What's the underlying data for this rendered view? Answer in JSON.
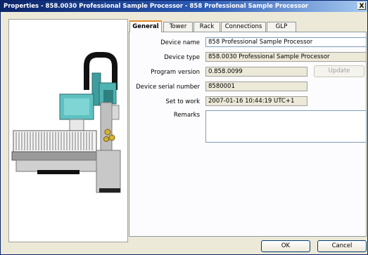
{
  "window": {
    "title": "Properties - 858.0030 Professional Sample Processor - 858 Professional Sample Processor",
    "close_label": "X"
  },
  "tabs": [
    "General",
    "Tower",
    "Rack",
    "Connections",
    "GLP"
  ],
  "general": {
    "device_name_label": "Device name",
    "device_name_value": "858 Professional Sample Processor",
    "device_type_label": "Device type",
    "device_type_value": "858.0030 Professional Sample Processor",
    "program_version_label": "Program version",
    "program_version_value": "0.858.0099",
    "update_label": "Update",
    "serial_label": "Device serial number",
    "serial_value": "8580001",
    "set_to_work_label": "Set to work",
    "set_to_work_value": "2007-01-16 10:44:19 UTC+1",
    "remarks_label": "Remarks",
    "remarks_value": ""
  },
  "footer": {
    "ok_label": "OK",
    "cancel_label": "Cancel"
  },
  "colors": {
    "accent_teal": "#3f9d9d",
    "titlebar": "#0a246a"
  }
}
